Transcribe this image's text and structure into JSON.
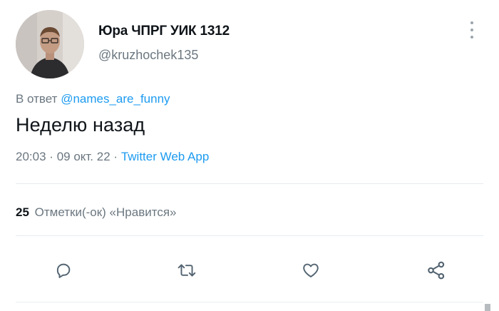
{
  "author": {
    "display_name": "Юра ЧПРГ УИК 1312",
    "handle": "@kruzhochek135"
  },
  "reply": {
    "prefix": "В ответ",
    "mention": "@names_are_funny"
  },
  "tweet": {
    "text": "Неделю назад",
    "time": "20:03",
    "date": "09 окт. 22",
    "source": "Twitter Web App",
    "separator": "·"
  },
  "likes": {
    "count": "25",
    "label": "Отметки(-ок) «Нравится»"
  },
  "actions": {
    "icons": [
      "reply-icon",
      "retweet-icon",
      "like-icon",
      "share-icon"
    ],
    "icon_color": "#536471"
  },
  "colors": {
    "link": "#1d9bf0",
    "secondary_text": "#6b7780",
    "primary_text": "#0f1419"
  }
}
